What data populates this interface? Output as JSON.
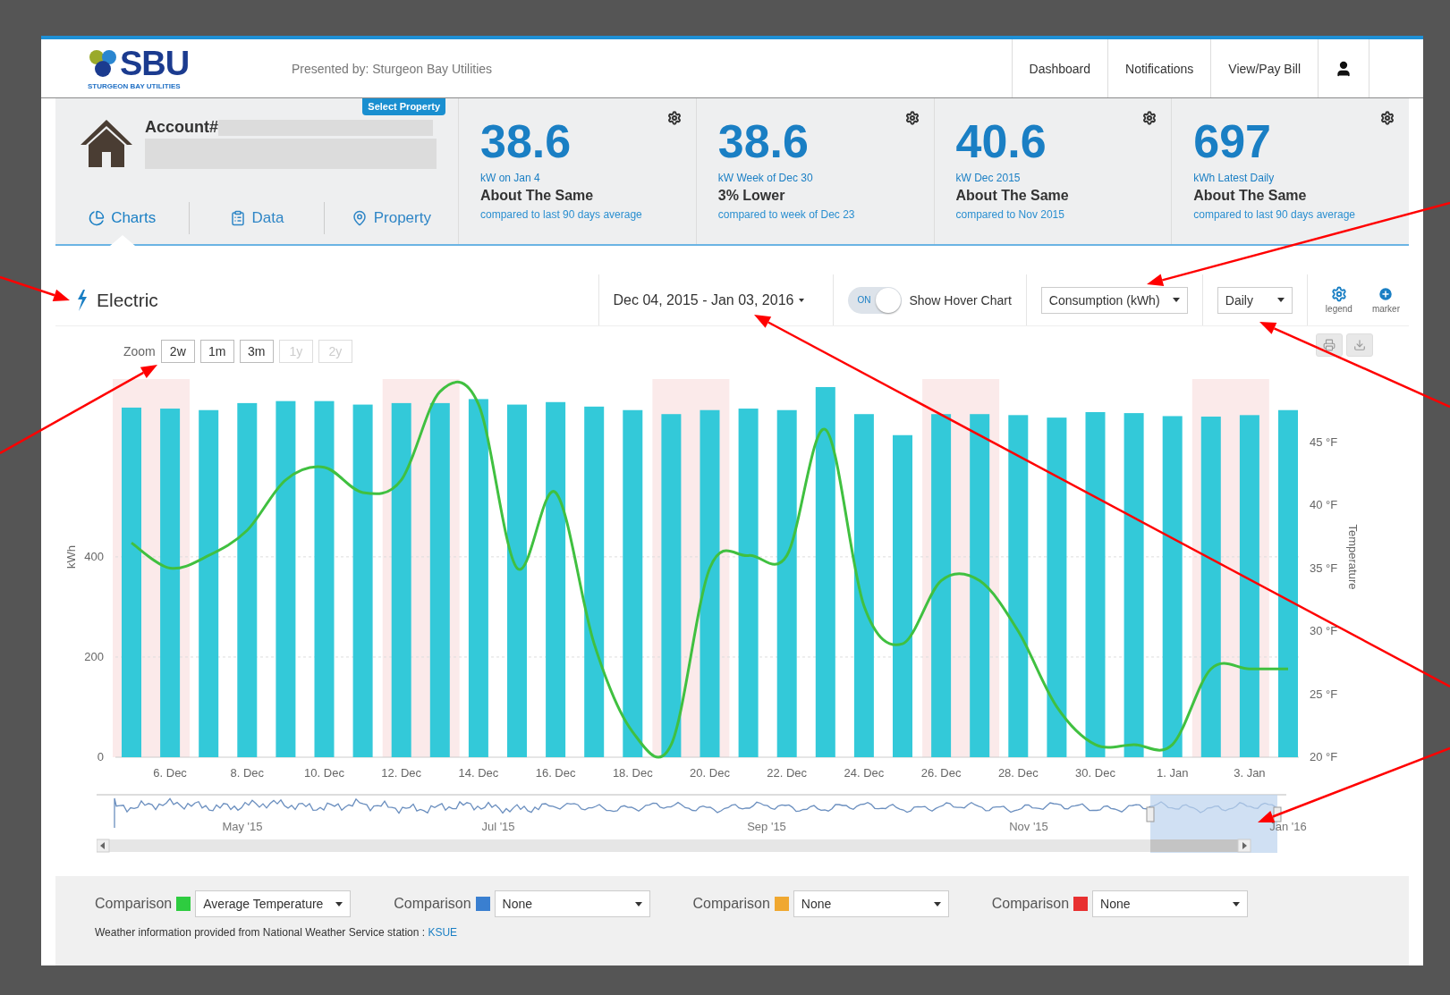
{
  "header": {
    "logo": {
      "text": "SBU",
      "subtext": "STURGEON BAY UTILITIES"
    },
    "tagline": "Presented by: Sturgeon Bay Utilities",
    "nav": [
      {
        "label": "Dashboard"
      },
      {
        "label": "Notifications"
      },
      {
        "label": "View/Pay Bill"
      }
    ]
  },
  "account": {
    "label": "Account#",
    "badge": "Select Property",
    "tabs": [
      {
        "label": "Charts",
        "selected": true
      },
      {
        "label": "Data",
        "selected": false
      },
      {
        "label": "Property",
        "selected": false
      }
    ]
  },
  "stats": [
    {
      "value": "38.6",
      "unit": "kW on Jan 4",
      "comparison": "About The Same",
      "basis": "compared to last 90 days average"
    },
    {
      "value": "38.6",
      "unit": "kW Week of Dec 30",
      "comparison": "3% Lower",
      "basis": "compared to week of Dec 23"
    },
    {
      "value": "40.6",
      "unit": "kW Dec 2015",
      "comparison": "About The Same",
      "basis": "compared to Nov 2015"
    },
    {
      "value": "697",
      "unit": "kWh Latest Daily",
      "comparison": "About The Same",
      "basis": "compared to last 90 days average"
    }
  ],
  "toolbar": {
    "title": "Electric",
    "date_range": "Dec 04, 2015 - Jan 03, 2016",
    "hover_toggle": {
      "state_label": "ON",
      "on": true,
      "label": "Show Hover Chart"
    },
    "measure": "Consumption (kWh)",
    "interval": "Daily",
    "actions": [
      {
        "label": "legend"
      },
      {
        "label": "marker"
      }
    ]
  },
  "zoom": {
    "label": "Zoom",
    "buttons": [
      {
        "label": "2w",
        "disabled": false
      },
      {
        "label": "1m",
        "disabled": false
      },
      {
        "label": "3m",
        "disabled": false
      },
      {
        "label": "1y",
        "disabled": true
      },
      {
        "label": "2y",
        "disabled": true
      }
    ]
  },
  "chart": {
    "chart_data": {
      "type": "bar",
      "ylabel": "kWh",
      "y2label": "Temperature",
      "ylim": [
        0,
        755
      ],
      "y2lim": [
        20,
        50
      ],
      "yticks": [
        0,
        200,
        400
      ],
      "y2ticks": [
        {
          "value": 20,
          "label": "20 °F"
        },
        {
          "value": 25,
          "label": "25 °F"
        },
        {
          "value": 30,
          "label": "30 °F"
        },
        {
          "value": 35,
          "label": "35 °F"
        },
        {
          "value": 40,
          "label": "40 °F"
        },
        {
          "value": 45,
          "label": "45 °F"
        }
      ],
      "categories": [
        null,
        "6. Dec",
        null,
        "8. Dec",
        null,
        "10. Dec",
        null,
        "12. Dec",
        null,
        "14. Dec",
        null,
        "16. Dec",
        null,
        "18. Dec",
        null,
        "20. Dec",
        null,
        "22. Dec",
        null,
        "24. Dec",
        null,
        "26. Dec",
        null,
        "28. Dec",
        null,
        "30. Dec",
        null,
        "1. Jan",
        null,
        "3. Jan",
        null
      ],
      "series": [
        {
          "color": "#33c9d9",
          "values": [
            698,
            696,
            693,
            707,
            711,
            711,
            704,
            707,
            707,
            715,
            704,
            709,
            700,
            693,
            685,
            693,
            696,
            693,
            739,
            685,
            643,
            685,
            685,
            683,
            678,
            689,
            687,
            681,
            680,
            683,
            693
          ]
        },
        {
          "type": "line",
          "axis": "y2",
          "color": "#40c040",
          "values": [
            37,
            35,
            36,
            38,
            42,
            43,
            41,
            42,
            49,
            48,
            35,
            41,
            29,
            22,
            21,
            35,
            36,
            36,
            46,
            32,
            29,
            34,
            34,
            30,
            24,
            21,
            21,
            21,
            27,
            27,
            27
          ]
        }
      ]
    }
  },
  "navigator": {
    "labels": [
      "May '15",
      "Jul '15",
      "Sep '15",
      "Nov '15",
      "Jan '16"
    ]
  },
  "comparisons": [
    {
      "label": "Comparison",
      "color": "#2ecc40",
      "value": "Average Temperature"
    },
    {
      "label": "Comparison",
      "color": "#3a7fd0",
      "value": "None"
    },
    {
      "label": "Comparison",
      "color": "#f0a830",
      "value": "None"
    },
    {
      "label": "Comparison",
      "color": "#e83030",
      "value": "None"
    }
  ],
  "footnote": {
    "text": "Weather information provided from National Weather Service station : ",
    "link": "KSUE"
  }
}
